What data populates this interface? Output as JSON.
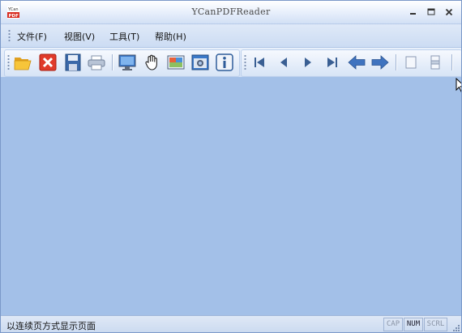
{
  "window": {
    "title": "YCanPDFReader",
    "app_icon": "ycan-pdf-icon"
  },
  "menu": [
    {
      "label": "文件(F)"
    },
    {
      "label": "视图(V)"
    },
    {
      "label": "工具(T)"
    },
    {
      "label": "帮助(H)"
    }
  ],
  "toolbar_icons": [
    "open-folder-icon",
    "close-document-icon",
    "save-icon",
    "print-icon",
    "fullscreen-monitor-icon",
    "hand-tool-icon",
    "select-image-icon",
    "snapshot-camera-icon",
    "info-icon",
    "first-page-icon",
    "previous-page-icon",
    "next-page-icon",
    "last-page-icon",
    "back-arrow-icon",
    "forward-arrow-icon",
    "single-page-icon",
    "continuous-page-icon"
  ],
  "status": {
    "text": "以连续页方式显示页面",
    "indicators": [
      {
        "label": "CAP",
        "active": false
      },
      {
        "label": "NUM",
        "active": true
      },
      {
        "label": "SCRL",
        "active": false
      }
    ]
  },
  "colors": {
    "workspace": "#a3c0e8",
    "accent_red": "#e03a2a",
    "nav_blue": "#2f5d9a"
  }
}
